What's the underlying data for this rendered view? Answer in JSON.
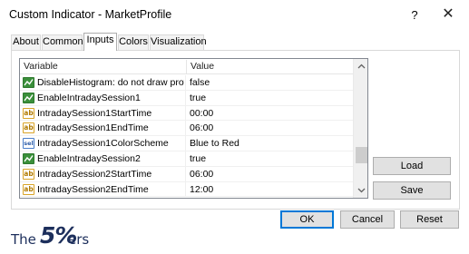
{
  "window": {
    "title": "Custom Indicator - MarketProfile",
    "help_glyph": "?",
    "close_glyph": "✕"
  },
  "tabs": [
    {
      "label": "About"
    },
    {
      "label": "Common"
    },
    {
      "label": "Inputs"
    },
    {
      "label": "Colors"
    },
    {
      "label": "Visualization"
    }
  ],
  "active_tab": "Inputs",
  "grid": {
    "col_variable": "Variable",
    "col_value": "Value",
    "rows": [
      {
        "icon": "bool-icon",
        "name": "DisableHistogram: do not draw profile, ...",
        "value": "false"
      },
      {
        "icon": "bool-icon",
        "name": "EnableIntradaySession1",
        "value": "true"
      },
      {
        "icon": "string-icon",
        "name": "IntradaySession1StartTime",
        "value": "00:00"
      },
      {
        "icon": "string-icon",
        "name": "IntradaySession1EndTime",
        "value": "06:00"
      },
      {
        "icon": "color-scheme-icon",
        "name": "IntradaySession1ColorScheme",
        "value": "Blue to Red"
      },
      {
        "icon": "bool-icon",
        "name": "EnableIntradaySession2",
        "value": "true"
      },
      {
        "icon": "string-icon",
        "name": "IntradaySession2StartTime",
        "value": "06:00"
      },
      {
        "icon": "string-icon",
        "name": "IntradaySession2EndTime",
        "value": "12:00"
      }
    ],
    "icon_text": {
      "string-icon": "ab",
      "color-scheme-icon": "sel"
    }
  },
  "buttons": {
    "load": "Load",
    "save": "Save",
    "ok": "OK",
    "cancel": "Cancel",
    "reset": "Reset"
  },
  "watermark": {
    "the": "The",
    "five": "5%",
    "ers": "ers"
  },
  "colors": {
    "accent": "#0078d7",
    "bool_icon": "#3a8f3a",
    "logo": "#1d2f5c"
  }
}
